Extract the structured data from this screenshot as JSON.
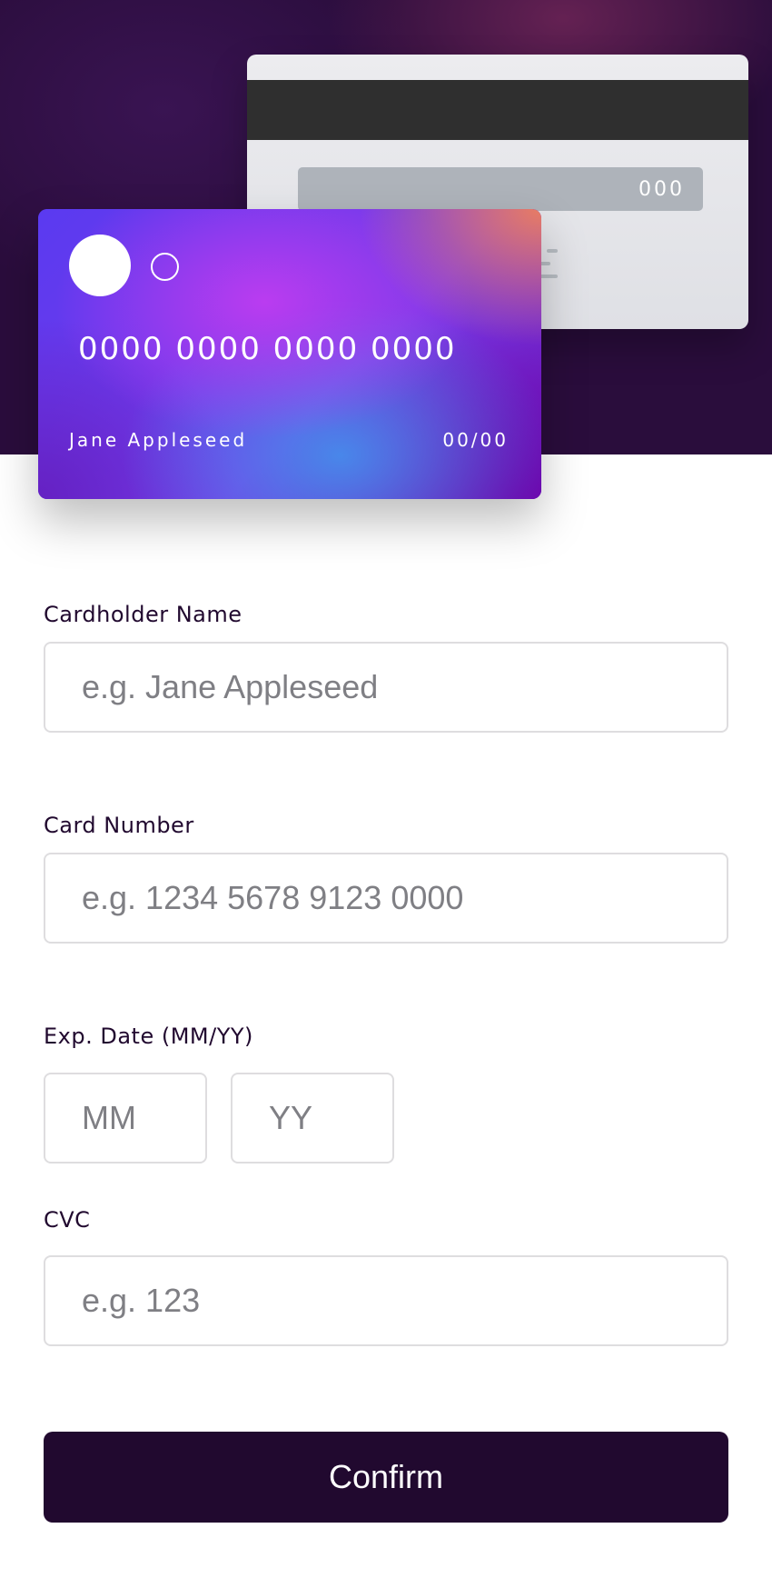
{
  "card_back": {
    "cvc": "000"
  },
  "card_front": {
    "number": "0000 0000 0000 0000",
    "name": "Jane Appleseed",
    "expiry": "00/00"
  },
  "form": {
    "name": {
      "label": "Cardholder Name",
      "placeholder": "e.g. Jane Appleseed"
    },
    "number": {
      "label": "Card Number",
      "placeholder": "e.g. 1234 5678 9123 0000"
    },
    "expiry": {
      "label": "Exp. Date (MM/YY)",
      "month_placeholder": "MM",
      "year_placeholder": "YY"
    },
    "cvc": {
      "label": "CVC",
      "placeholder": "e.g. 123"
    },
    "confirm_label": "Confirm"
  },
  "colors": {
    "hero_bg": "#2a0d3c",
    "button_bg": "#21092f",
    "input_border": "#dedddf"
  }
}
